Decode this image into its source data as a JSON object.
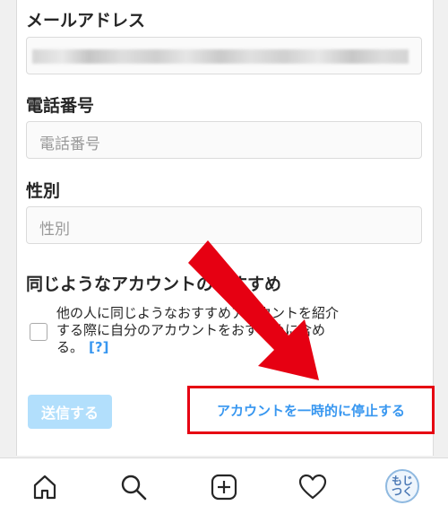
{
  "form": {
    "email_label": "メールアドレス",
    "phone_label": "電話番号",
    "phone_placeholder": "電話番号",
    "gender_label": "性別",
    "gender_placeholder": "性別",
    "recommend_label": "同じようなアカウントのおすすめ",
    "recommend_text": "他の人に同じようなおすすめアカウントを紹介する際に自分のアカウントをおすすめに含める。",
    "help_link": "[?]",
    "submit_label": "送信する",
    "deactivate_link": "アカウントを一時的に停止する"
  },
  "bottom_nav": {
    "items": [
      "home-icon",
      "search-icon",
      "new-post-icon",
      "activity-heart-icon",
      "profile-avatar"
    ],
    "avatar_text": "もじつく"
  },
  "colors": {
    "accent": "#3897f0",
    "submit_disabled": "#b2dffc",
    "annotation_red": "#e60012"
  }
}
